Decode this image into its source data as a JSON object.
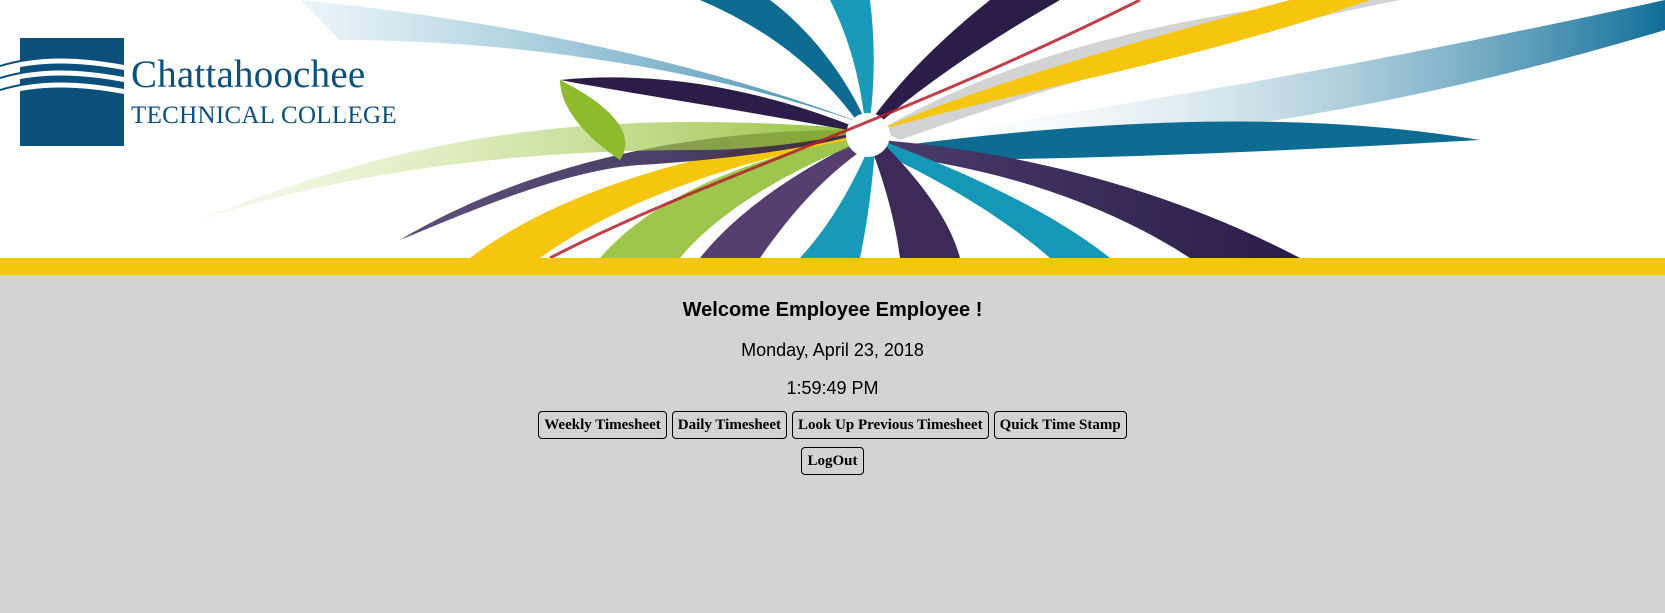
{
  "header": {
    "logo_line1": "Chattahoochee",
    "logo_line2": "TECHNICAL COLLEGE",
    "stripe_color": "#f6c60f",
    "brand_color": "#0b4f7d"
  },
  "main": {
    "welcome": "Welcome Employee Employee !",
    "date": "Monday, April 23, 2018",
    "time": "1:59:49 PM",
    "buttons": {
      "weekly_timesheet": "Weekly Timesheet",
      "daily_timesheet": "Daily Timesheet",
      "lookup_previous_timesheet": "Look Up Previous Timesheet",
      "quick_time_stamp": "Quick Time Stamp",
      "logout": "LogOut"
    }
  }
}
